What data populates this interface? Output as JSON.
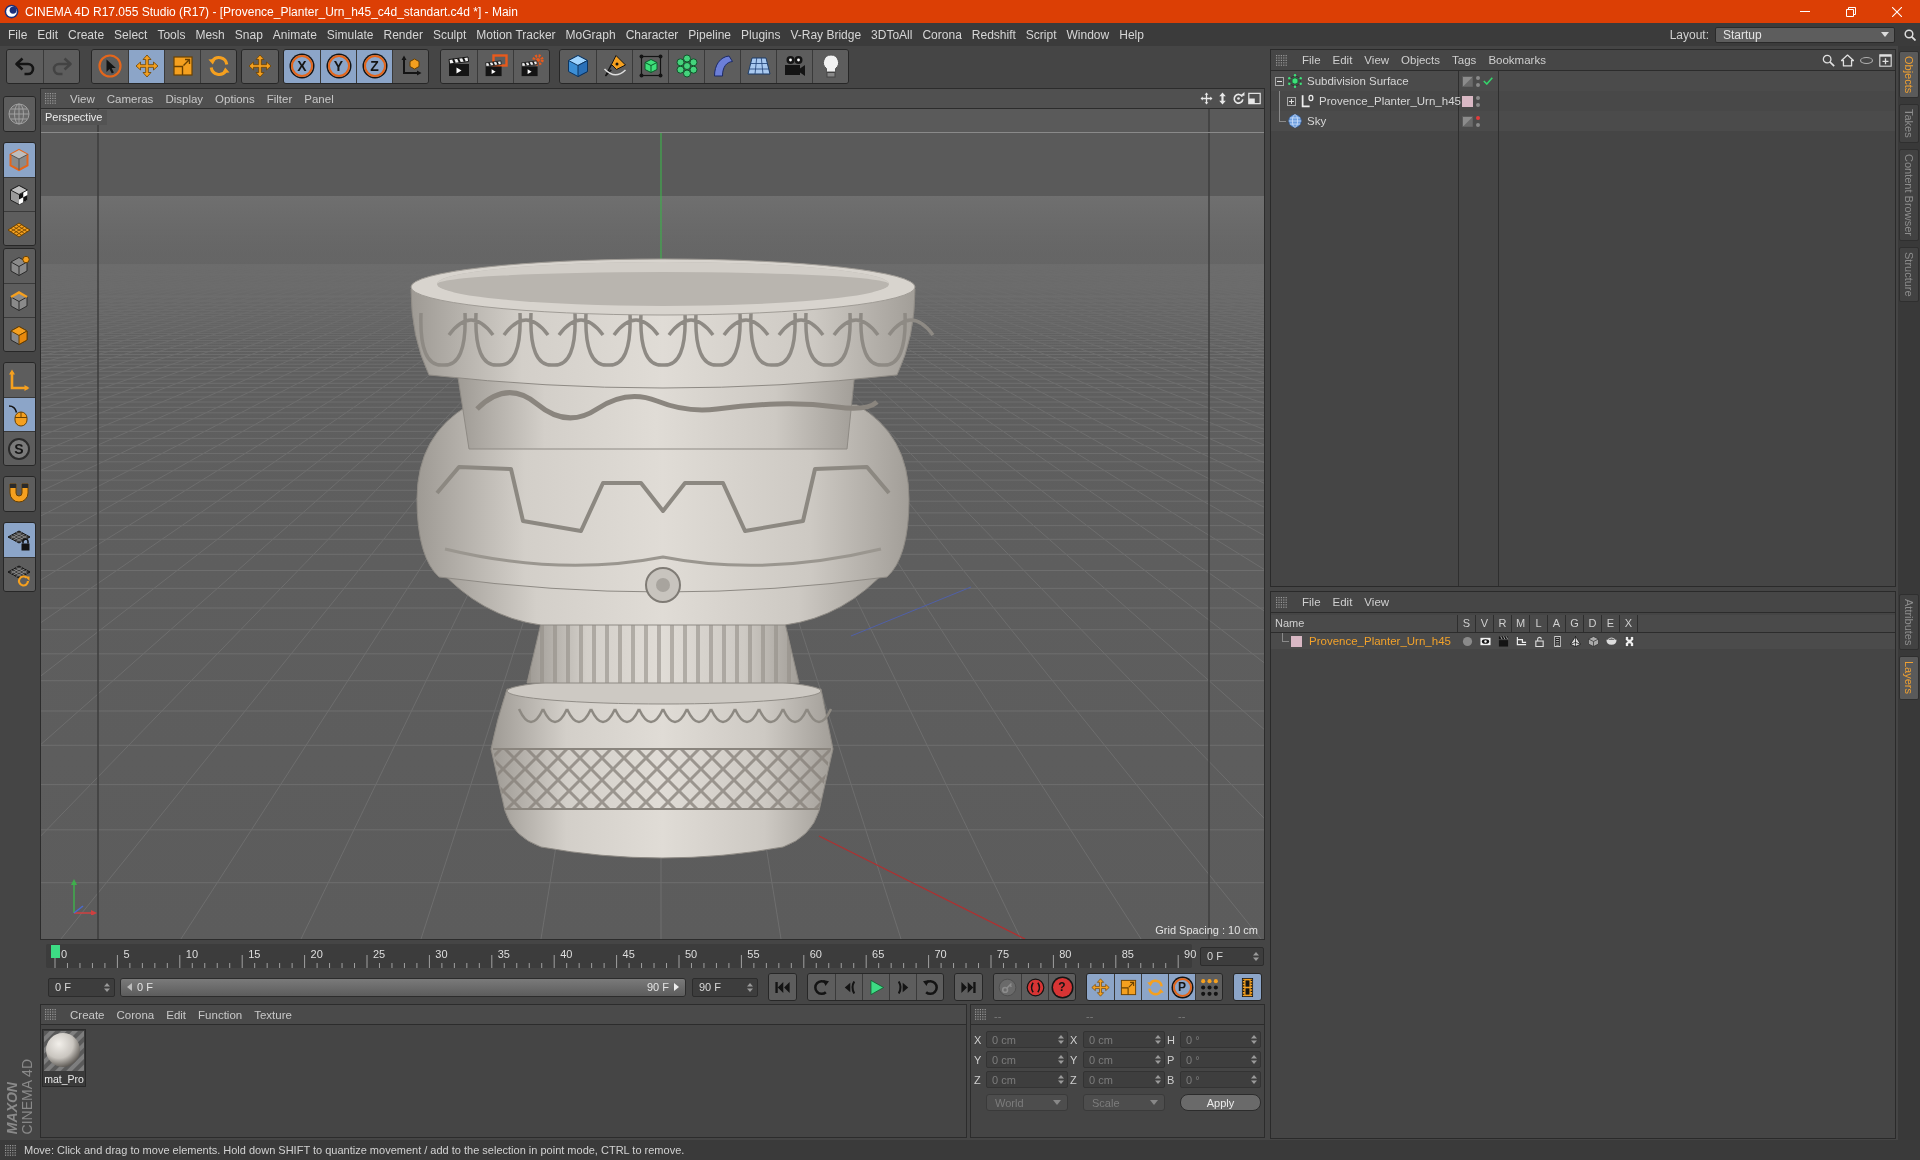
{
  "window": {
    "title": "CINEMA 4D R17.055 Studio (R17) - [Provence_Planter_Urn_h45_c4d_standart.c4d *] - Main"
  },
  "menu_bar": {
    "items": [
      "File",
      "Edit",
      "Create",
      "Select",
      "Tools",
      "Mesh",
      "Snap",
      "Animate",
      "Simulate",
      "Render",
      "Sculpt",
      "Motion Tracker",
      "MoGraph",
      "Character",
      "Pipeline",
      "Plugins",
      "V-Ray Bridge",
      "3DToAll",
      "Corona",
      "Redshift",
      "Script",
      "Window",
      "Help"
    ],
    "layout_label": "Layout:",
    "layout_value": "Startup"
  },
  "toolbar": [
    {
      "tools": [
        {
          "active": false,
          "disabled": false
        },
        {
          "active": false,
          "disabled": true
        }
      ]
    },
    {
      "tools": [
        {
          "active": false,
          "disabled": false
        },
        {
          "active": true,
          "disabled": false
        },
        {
          "active": false,
          "disabled": false
        },
        {
          "active": false,
          "disabled": false
        }
      ]
    },
    {
      "tools": [
        {
          "active": false,
          "disabled": false
        }
      ]
    },
    {
      "tools": [
        {
          "label": "X",
          "active": true,
          "disabled": false
        },
        {
          "label": "Y",
          "active": true,
          "disabled": false
        },
        {
          "label": "Z",
          "active": true,
          "disabled": false
        },
        {
          "active": false,
          "disabled": false
        }
      ]
    },
    {
      "tools": [
        {
          "active": false,
          "disabled": false
        },
        {
          "active": false,
          "disabled": false
        },
        {
          "active": false,
          "disabled": false
        }
      ]
    },
    {
      "tools": [
        {
          "active": false,
          "disabled": false
        },
        {
          "active": false,
          "disabled": false
        },
        {
          "active": false,
          "disabled": false
        },
        {
          "active": false,
          "disabled": false
        },
        {
          "active": false,
          "disabled": false
        },
        {
          "active": false,
          "disabled": false
        },
        {
          "active": false,
          "disabled": false
        },
        {
          "active": false,
          "disabled": false
        }
      ]
    }
  ],
  "mode_toolbar": [
    {
      "tools": [
        {
          "active": false
        }
      ]
    },
    {
      "tools": [
        {
          "active": true
        },
        {
          "active": false
        },
        {
          "active": false
        }
      ]
    },
    {
      "tools": [
        {
          "active": false
        },
        {
          "active": false
        },
        {
          "active": false
        }
      ]
    },
    {
      "tools": [
        {
          "active": false
        },
        {
          "active": true
        },
        {
          "label": "S",
          "active": false
        }
      ]
    },
    {
      "tools": [
        {
          "active": false
        }
      ]
    },
    {
      "tools": [
        {
          "active": true
        },
        {
          "active": false
        }
      ]
    }
  ],
  "logo": {
    "brand": "MAXON",
    "product": "CINEMA 4D"
  },
  "viewport": {
    "menu": [
      "View",
      "Cameras",
      "Display",
      "Options",
      "Filter",
      "Panel"
    ],
    "camera": "Perspective",
    "grid_spacing": "Grid Spacing : 10 cm"
  },
  "timeline": {
    "frame_labels": [
      "0",
      "5",
      "10",
      "15",
      "20",
      "25",
      "30",
      "35",
      "40",
      "45",
      "50",
      "55",
      "60",
      "65",
      "70",
      "75",
      "80",
      "85",
      "90"
    ],
    "playhead": {
      "level": 0
    },
    "current_frame": "0 F"
  },
  "playback": {
    "start_field": "0 F",
    "range": {
      "start": "0 F",
      "end": "90 F",
      "level": 1
    },
    "end_field": "90 F",
    "buttons": [
      {
        "tools": [
          {
            "active": false
          }
        ]
      },
      {
        "tools": [
          {
            "active": false
          },
          {
            "active": false
          },
          {
            "active": false
          },
          {
            "active": false
          },
          {
            "active": false
          }
        ]
      },
      {
        "tools": [
          {
            "active": false
          }
        ]
      },
      {
        "tools": [
          {
            "active": false
          },
          {
            "active": false
          },
          {
            "label": "?",
            "active": false
          }
        ]
      },
      {
        "tools": [
          {
            "active": true
          },
          {
            "active": true
          },
          {
            "active": true
          },
          {
            "label": "P",
            "active": true
          },
          {
            "active": false
          }
        ]
      },
      {
        "tools": [
          {
            "active": true
          }
        ]
      }
    ]
  },
  "material_manager": {
    "menu": [
      "Create",
      "Corona",
      "Edit",
      "Function",
      "Texture"
    ],
    "materials": [
      {
        "name": "mat_Pro"
      }
    ]
  },
  "coordinates": {
    "disabled": true,
    "headers": [
      "--",
      "--",
      "--"
    ],
    "rows": [
      {
        "cells": [
          {
            "axis": "X",
            "value": "0 cm"
          },
          {
            "axis": "X",
            "value": "0 cm"
          },
          {
            "axis": "H",
            "value": "0 °"
          }
        ]
      },
      {
        "cells": [
          {
            "axis": "Y",
            "value": "0 cm"
          },
          {
            "axis": "Y",
            "value": "0 cm"
          },
          {
            "axis": "P",
            "value": "0 °"
          }
        ]
      },
      {
        "cells": [
          {
            "axis": "Z",
            "value": "0 cm"
          },
          {
            "axis": "Z",
            "value": "0 cm"
          },
          {
            "axis": "B",
            "value": "0 °"
          }
        ]
      }
    ],
    "dropdowns": [
      "World",
      "Scale"
    ],
    "apply": "Apply"
  },
  "object_manager": {
    "menu": [
      "File",
      "Edit",
      "View",
      "Objects",
      "Tags",
      "Bookmarks"
    ],
    "objects": [
      {
        "name": "Subdivision Surface",
        "kind": "subdivision",
        "expanded": true,
        "editor_hidden": false,
        "render_hidden": false,
        "check": true,
        "children": [
          {
            "name": "Provence_Planter_Urn_h45",
            "kind": "null",
            "expanded": false,
            "color": "#d9b8c4",
            "editor_hidden": false,
            "render_hidden": false,
            "check": false
          }
        ]
      },
      {
        "name": "Sky",
        "kind": "sky",
        "editor_hidden": true,
        "render_hidden": false,
        "check": false
      }
    ]
  },
  "layer_manager": {
    "menu": [
      "File",
      "Edit",
      "View"
    ],
    "columns": [
      "Name",
      "S",
      "V",
      "R",
      "M",
      "L",
      "A",
      "G",
      "D",
      "E",
      "X"
    ],
    "layers": [
      {
        "name": "Provence_Planter_Urn_h45",
        "color": "#d9b8c4",
        "selected": true
      }
    ]
  },
  "side_tabs": {
    "upper": [
      {
        "label": "Objects",
        "selected": true
      },
      {
        "label": "Takes",
        "selected": false
      },
      {
        "label": "Content Browser",
        "selected": false
      },
      {
        "label": "Structure",
        "selected": false
      }
    ],
    "lower": [
      {
        "label": "Attributes",
        "selected": false
      },
      {
        "label": "Layers",
        "selected": true
      }
    ]
  },
  "status_bar": {
    "text": "Move: Click and drag to move elements. Hold down SHIFT to quantize movement / add to the selection in point mode, CTRL to remove."
  }
}
